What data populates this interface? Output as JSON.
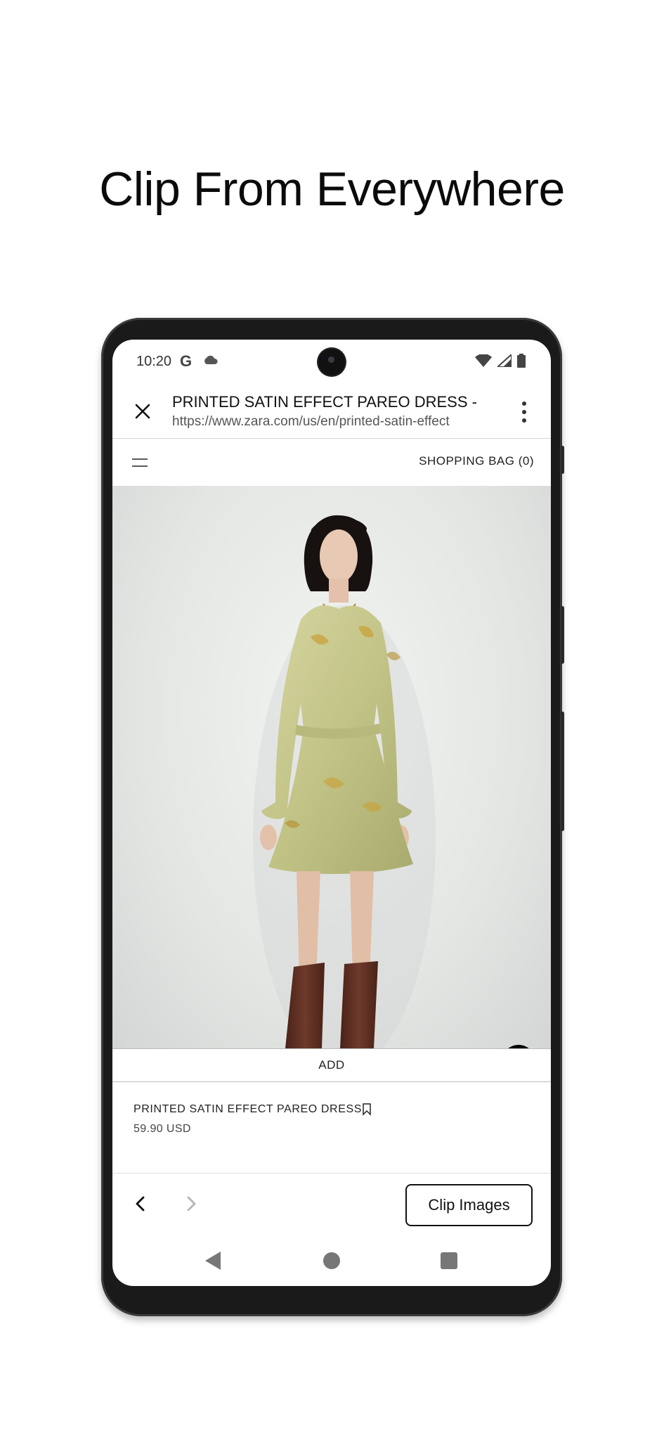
{
  "headline": "Clip From Everywhere",
  "status": {
    "time": "10:20",
    "g_glyph": "G",
    "icons": [
      "google-icon",
      "cloud-icon",
      "wifi-icon",
      "signal-icon",
      "battery-icon"
    ]
  },
  "browser": {
    "page_title": "PRINTED SATIN EFFECT PAREO DRESS -",
    "url": "https://www.zara.com/us/en/printed-satin-effect"
  },
  "site": {
    "shopping_bag": "SHOPPING BAG (0)"
  },
  "product": {
    "add_label": "ADD",
    "name": "PRINTED SATIN EFFECT PAREO DRESS",
    "price": "59.90 USD"
  },
  "actions": {
    "clip_images": "Clip Images"
  },
  "colors": {
    "accent": "#111111",
    "dress": "#c9c98a",
    "boots": "#5c2e22",
    "background": "#ffffff"
  }
}
